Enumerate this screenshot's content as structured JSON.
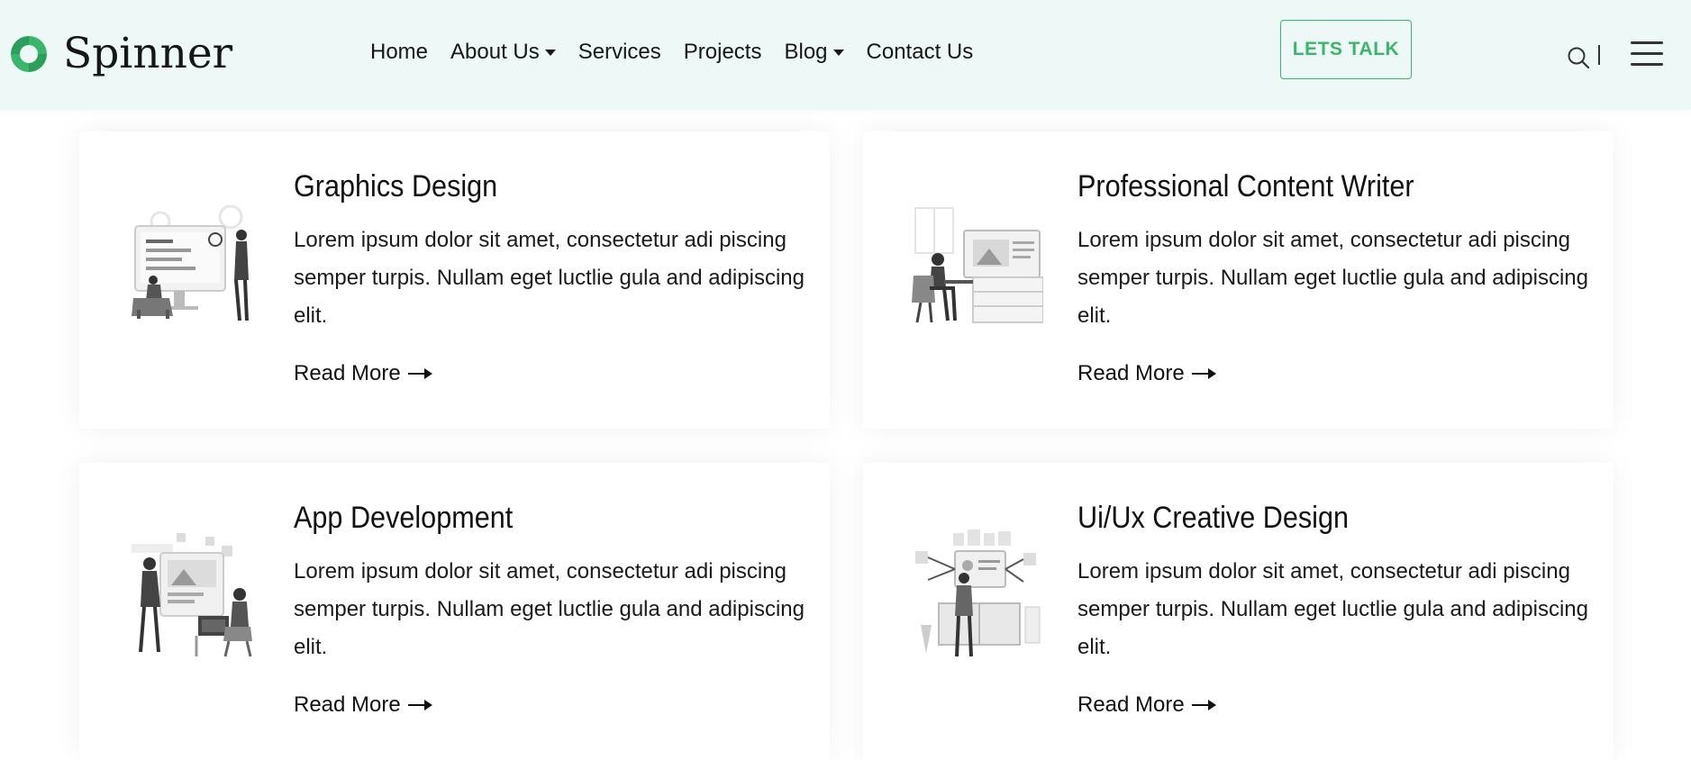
{
  "brand": {
    "name": "Spinner",
    "accent": "#3bb56b"
  },
  "nav": {
    "items": [
      {
        "label": "Home",
        "dropdown": false
      },
      {
        "label": "About Us",
        "dropdown": true
      },
      {
        "label": "Services",
        "dropdown": false
      },
      {
        "label": "Projects",
        "dropdown": false
      },
      {
        "label": "Blog",
        "dropdown": true
      },
      {
        "label": "Contact Us",
        "dropdown": false
      }
    ],
    "cta_label": "LETS TALK"
  },
  "icons": {
    "search": "search-icon",
    "menu": "hamburger-menu-icon",
    "arrow": "arrow-right-icon"
  },
  "services": [
    {
      "title": "Graphics Design",
      "description": "Lorem ipsum dolor sit amet, consectetur adi piscing semper turpis. Nullam eget luctlie gula and adipiscing elit.",
      "link": "Read More"
    },
    {
      "title": "Professional Content Writer",
      "description": "Lorem ipsum dolor sit amet, consectetur adi piscing semper turpis. Nullam eget luctlie gula and adipiscing elit.",
      "link": "Read More"
    },
    {
      "title": "App Development",
      "description": "Lorem ipsum dolor sit amet, consectetur adi piscing semper turpis. Nullam eget luctlie gula and adipiscing elit.",
      "link": "Read More"
    },
    {
      "title": "Ui/Ux Creative Design",
      "description": "Lorem ipsum dolor sit amet, consectetur adi piscing semper turpis. Nullam eget luctlie gula and adipiscing elit.",
      "link": "Read More"
    }
  ]
}
